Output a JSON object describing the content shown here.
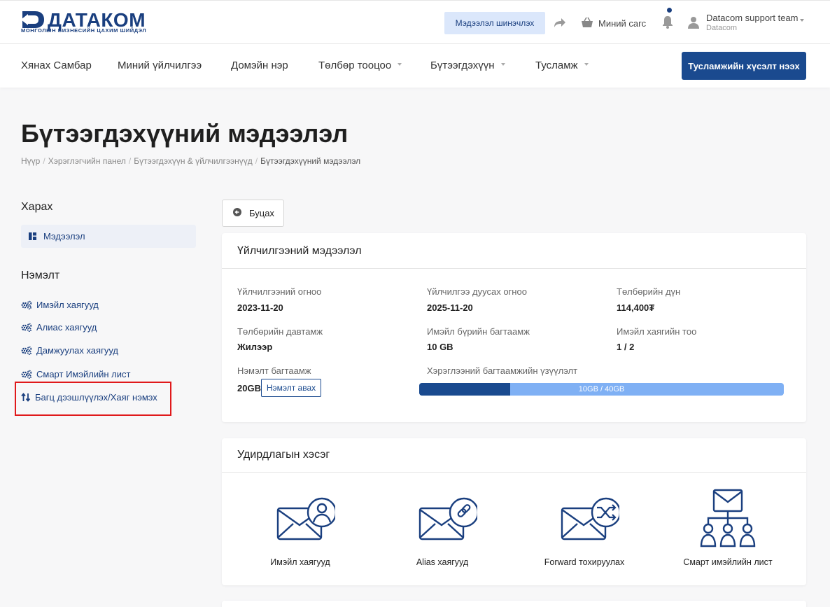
{
  "header": {
    "logo_text": "ДАТАКОМ",
    "logo_tagline": "МОНГОЛЫН БИЗНЕСИЙН ЦАХИМ ШИЙДЭЛ",
    "refresh_label": "Мэдээлэл шинэчлэх",
    "basket_label": "Миний сагс",
    "user_name": "Datacom support team",
    "user_org": "Datacom"
  },
  "nav": {
    "items": [
      {
        "label": "Хянах Самбар"
      },
      {
        "label": "Миний үйлчилгээ"
      },
      {
        "label": "Домэйн нэр"
      },
      {
        "label": "Төлбөр тооцоо"
      },
      {
        "label": "Бүтээгдэхүүн"
      },
      {
        "label": "Тусламж"
      }
    ],
    "support_button": "Тусламжийн хүсэлт нээх"
  },
  "page": {
    "title": "Бүтээгдэхүүний мэдээлэл",
    "breadcrumb": [
      "Нүүр",
      "Хэрэглэгчийн панел",
      "Бүтээгдэхүүн & үйлчилгээнүүд",
      "Бүтээгдэхүүний мэдээлэл"
    ]
  },
  "sidebar": {
    "view_heading": "Харах",
    "active_item": "Мэдээлэл",
    "extra_heading": "Нэмэлт",
    "links": [
      {
        "label": "Имэйл хаягууд",
        "icon": "cogs-icon"
      },
      {
        "label": "Алиас хаягууд",
        "icon": "cogs-icon"
      },
      {
        "label": "Дамжуулах хаягууд",
        "icon": "cogs-icon"
      },
      {
        "label": "Смарт Имэйлийн лист",
        "icon": "cogs-icon"
      },
      {
        "label": "Багц дээшлүүлэх/Хаяг нэмэх",
        "icon": "sort-arrows-icon"
      }
    ]
  },
  "back_button": "Буцах",
  "service": {
    "heading": "Үйлчилгээний мэдээлэл",
    "fields": {
      "start_date_label": "Үйлчилгээний огноо",
      "start_date": "2023-11-20",
      "end_date_label": "Үйлчилгээ дуусах огноо",
      "end_date": "2025-11-20",
      "amount_label": "Төлбөрийн дүн",
      "amount": "114,400₮",
      "cycle_label": "Төлбөрийн давтамж",
      "cycle": "Жилээр",
      "quota_label": "Имэйл бүрийн багтаамж",
      "quota": "10 GB",
      "email_count_label": "Имэйл хаягийн тоо",
      "email_count": "1 / 2",
      "extra_label": "Нэмэлт багтаамж",
      "extra": "20GB",
      "extra_button": "Нэмэлт авах",
      "usage_label": "Хэрэглээний багтаамжийн үзүүлэлт",
      "usage_text": "10GB / 40GB",
      "usage_fraction": 0.25
    }
  },
  "management": {
    "heading": "Удирдлагын хэсэг",
    "tools": [
      {
        "label": "Имэйл хаягууд",
        "icon": "mail-user-icon"
      },
      {
        "label": "Alias хаягууд",
        "icon": "mail-link-icon"
      },
      {
        "label": "Forward тохируулах",
        "icon": "mail-forward-icon"
      },
      {
        "label": "Смарт имэйлийн лист",
        "icon": "mail-hierarchy-icon"
      }
    ]
  },
  "colors": {
    "brand": "#1a4a8f",
    "link": "#1a3f7f",
    "usage_bg": "#7fb0f4",
    "highlight": "#e0191b"
  }
}
